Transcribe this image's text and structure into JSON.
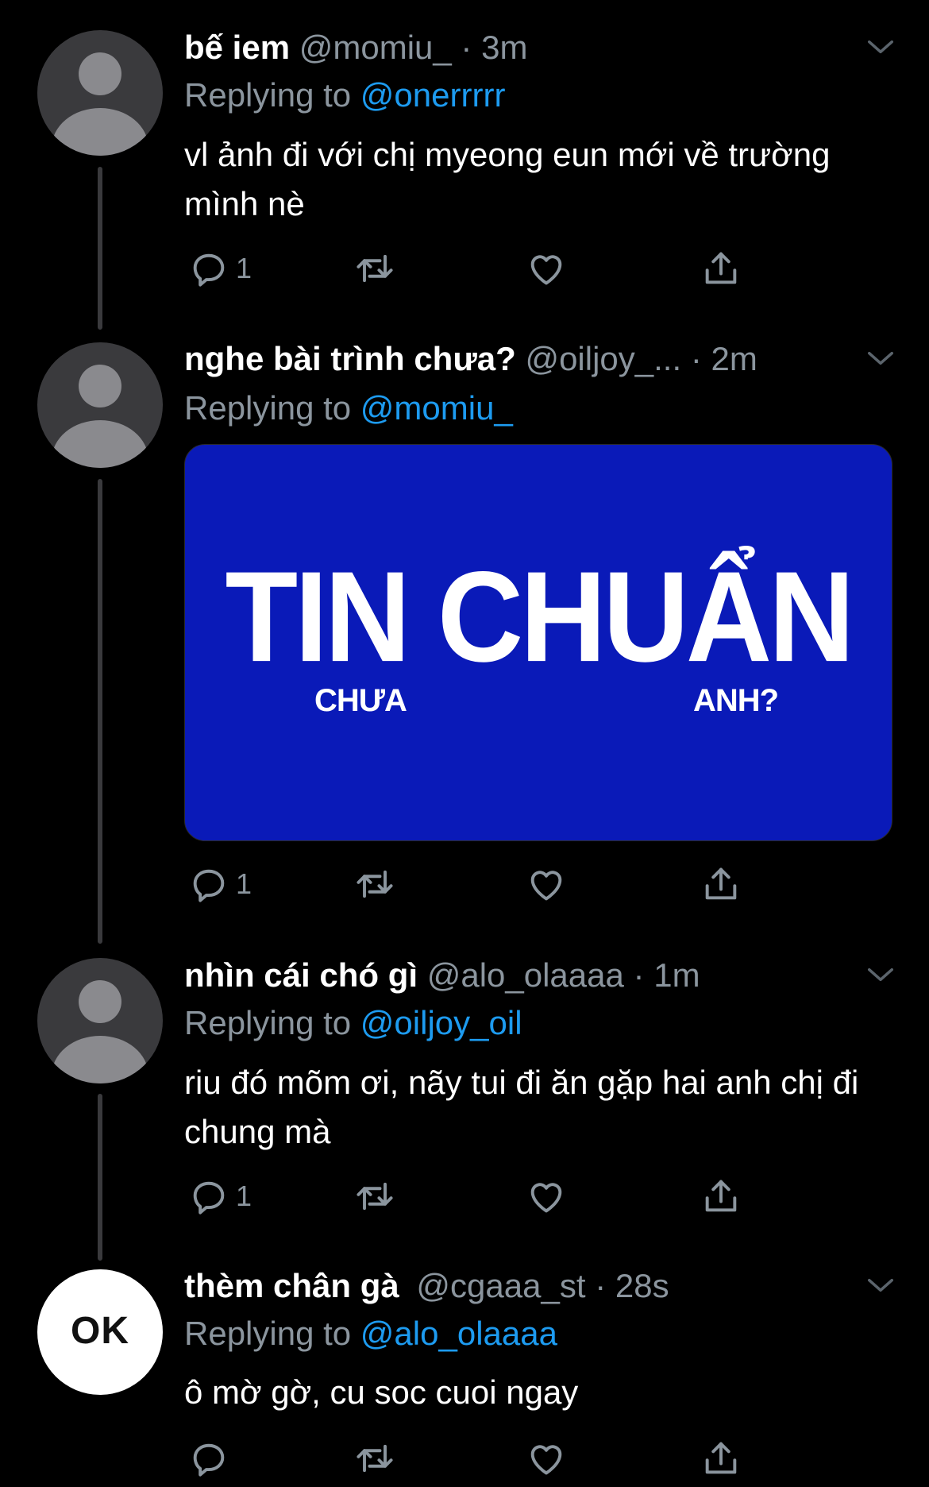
{
  "tweets": [
    {
      "name": "bế iem",
      "handle": "@momiu_",
      "dot": "·",
      "time": "3m",
      "replying_prefix": "Replying to",
      "replying_to": "@onerrrrr",
      "text": "vl ảnh đi với chị myeong eun mới về trường mình nè",
      "reply_count": "1"
    },
    {
      "name": "nghe bài trình chưa?",
      "handle": "@oiljoy_...",
      "dot": "·",
      "time": "2m",
      "replying_prefix": "Replying to",
      "replying_to": "@momiu_",
      "media": {
        "title": "TIN CHUẨN",
        "left": "CHƯA",
        "right": "ANH?",
        "background": "#0a1ab8"
      },
      "reply_count": "1"
    },
    {
      "name": "nhìn cái chó gì",
      "handle": "@alo_olaaaa",
      "dot": "·",
      "time": "1m",
      "replying_prefix": "Replying to",
      "replying_to": "@oiljoy_oil",
      "text": "riu đó mõm ơi, nãy tui đi ăn gặp hai anh chị đi chung mà",
      "reply_count": "1"
    },
    {
      "name": "thèm chân gà",
      "handle": "@cgaaa_st",
      "dot": "·",
      "time": "28s",
      "replying_prefix": "Replying to",
      "replying_to": "@alo_olaaaa",
      "avatar_text": "OK",
      "text": "ô mờ gờ, cu soc cuoi ngay",
      "reply_count": ""
    }
  ],
  "colors": {
    "background": "#000000",
    "muted": "#8b959e",
    "link": "#1d9bf0",
    "thread_line": "#3a3a3d"
  },
  "icons": [
    "reply-icon",
    "retweet-icon",
    "like-icon",
    "share-icon",
    "chevron-down-icon"
  ]
}
